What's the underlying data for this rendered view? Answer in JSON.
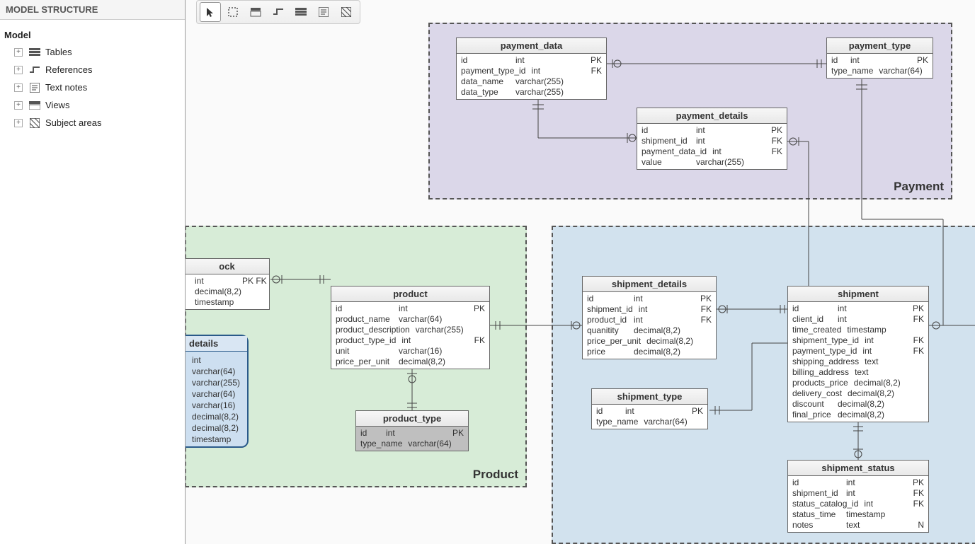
{
  "sidebar": {
    "header": "MODEL STRUCTURE",
    "root": "Model",
    "items": [
      {
        "label": "Tables",
        "icon": "tables"
      },
      {
        "label": "References",
        "icon": "references"
      },
      {
        "label": "Text notes",
        "icon": "notes"
      },
      {
        "label": "Views",
        "icon": "views"
      },
      {
        "label": "Subject areas",
        "icon": "areas"
      }
    ]
  },
  "toolbar": {
    "buttons": [
      "pointer",
      "select-area",
      "table",
      "reference",
      "view",
      "note",
      "subject-area"
    ]
  },
  "subject_areas": {
    "payment": "Payment",
    "product": "Product",
    "shipment": ""
  },
  "tables": {
    "payment_data": {
      "title": "payment_data",
      "rows": [
        {
          "name": "id",
          "type": "int",
          "key": "PK"
        },
        {
          "name": "payment_type_id",
          "type": "int",
          "key": "FK"
        },
        {
          "name": "data_name",
          "type": "varchar(255)",
          "key": ""
        },
        {
          "name": "data_type",
          "type": "varchar(255)",
          "key": ""
        }
      ]
    },
    "payment_type": {
      "title": "payment_type",
      "rows": [
        {
          "name": "id",
          "type": "int",
          "key": "PK"
        },
        {
          "name": "type_name",
          "type": "varchar(64)",
          "key": ""
        }
      ]
    },
    "payment_details": {
      "title": "payment_details",
      "rows": [
        {
          "name": "id",
          "type": "int",
          "key": "PK"
        },
        {
          "name": "shipment_id",
          "type": "int",
          "key": "FK"
        },
        {
          "name": "payment_data_id",
          "type": "int",
          "key": "FK"
        },
        {
          "name": "value",
          "type": "varchar(255)",
          "key": ""
        }
      ]
    },
    "stock": {
      "title": "ock",
      "rows": [
        {
          "name": "",
          "type": "int",
          "key": "PK FK"
        },
        {
          "name": "",
          "type": "decimal(8,2)",
          "key": ""
        },
        {
          "name": "",
          "type": "timestamp",
          "key": ""
        }
      ]
    },
    "product": {
      "title": "product",
      "rows": [
        {
          "name": "id",
          "type": "int",
          "key": "PK"
        },
        {
          "name": "product_name",
          "type": "varchar(64)",
          "key": ""
        },
        {
          "name": "product_description",
          "type": "varchar(255)",
          "key": ""
        },
        {
          "name": "product_type_id",
          "type": "int",
          "key": "FK"
        },
        {
          "name": "unit",
          "type": "varchar(16)",
          "key": ""
        },
        {
          "name": "price_per_unit",
          "type": "decimal(8,2)",
          "key": ""
        }
      ]
    },
    "product_type": {
      "title": "product_type",
      "rows": [
        {
          "name": "id",
          "type": "int",
          "key": "PK"
        },
        {
          "name": "type_name",
          "type": "varchar(64)",
          "key": ""
        }
      ]
    },
    "shipment_details": {
      "title": "shipment_details",
      "rows": [
        {
          "name": "id",
          "type": "int",
          "key": "PK"
        },
        {
          "name": "shipment_id",
          "type": "int",
          "key": "FK"
        },
        {
          "name": "product_id",
          "type": "int",
          "key": "FK"
        },
        {
          "name": "quanitity",
          "type": "decimal(8,2)",
          "key": ""
        },
        {
          "name": "price_per_unit",
          "type": "decimal(8,2)",
          "key": ""
        },
        {
          "name": "price",
          "type": "decimal(8,2)",
          "key": ""
        }
      ]
    },
    "shipment": {
      "title": "shipment",
      "rows": [
        {
          "name": "id",
          "type": "int",
          "key": "PK"
        },
        {
          "name": "client_id",
          "type": "int",
          "key": "FK"
        },
        {
          "name": "time_created",
          "type": "timestamp",
          "key": ""
        },
        {
          "name": "shipment_type_id",
          "type": "int",
          "key": "FK"
        },
        {
          "name": "payment_type_id",
          "type": "int",
          "key": "FK"
        },
        {
          "name": "shipping_address",
          "type": "text",
          "key": ""
        },
        {
          "name": "billing_address",
          "type": "text",
          "key": ""
        },
        {
          "name": "products_price",
          "type": "decimal(8,2)",
          "key": ""
        },
        {
          "name": "delivery_cost",
          "type": "decimal(8,2)",
          "key": ""
        },
        {
          "name": "discount",
          "type": "decimal(8,2)",
          "key": ""
        },
        {
          "name": "final_price",
          "type": "decimal(8,2)",
          "key": ""
        }
      ]
    },
    "shipment_type": {
      "title": "shipment_type",
      "rows": [
        {
          "name": "id",
          "type": "int",
          "key": "PK"
        },
        {
          "name": "type_name",
          "type": "varchar(64)",
          "key": ""
        }
      ]
    },
    "shipment_status": {
      "title": "shipment_status",
      "rows": [
        {
          "name": "id",
          "type": "int",
          "key": "PK"
        },
        {
          "name": "shipment_id",
          "type": "int",
          "key": "FK"
        },
        {
          "name": "status_catalog_id",
          "type": "int",
          "key": "FK"
        },
        {
          "name": "status_time",
          "type": "timestamp",
          "key": ""
        },
        {
          "name": "notes",
          "type": "text",
          "key": "N"
        }
      ]
    },
    "details": {
      "title": "details",
      "rows": [
        {
          "type": "int"
        },
        {
          "type": "varchar(64)"
        },
        {
          "type": "varchar(255)"
        },
        {
          "type": "varchar(64)"
        },
        {
          "type": "varchar(16)"
        },
        {
          "type": "decimal(8,2)"
        },
        {
          "type": "decimal(8,2)"
        },
        {
          "type": "timestamp"
        }
      ]
    }
  }
}
